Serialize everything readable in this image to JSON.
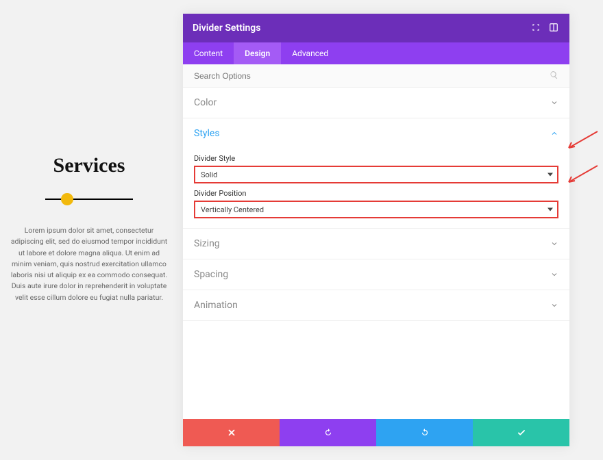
{
  "preview": {
    "title": "Services",
    "body": "Lorem ipsum dolor sit amet, consectetur adipiscing elit, sed do eiusmod tempor incididunt ut labore et dolore magna aliqua. Ut enim ad minim veniam, quis nostrud exercitation ullamco laboris nisi ut aliquip ex ea commodo consequat. Duis aute irure dolor in reprehenderit in voluptate velit esse cillum dolore eu fugiat nulla pariatur."
  },
  "panel": {
    "title": "Divider Settings",
    "search_placeholder": "Search Options"
  },
  "tabs": {
    "content": "Content",
    "design": "Design",
    "advanced": "Advanced",
    "active": "design"
  },
  "sections": {
    "color": {
      "title": "Color",
      "open": false
    },
    "styles": {
      "title": "Styles",
      "open": true,
      "divider_style_label": "Divider Style",
      "divider_style_value": "Solid",
      "divider_position_label": "Divider Position",
      "divider_position_value": "Vertically Centered"
    },
    "sizing": {
      "title": "Sizing",
      "open": false
    },
    "spacing": {
      "title": "Spacing",
      "open": false
    },
    "animation": {
      "title": "Animation",
      "open": false
    }
  }
}
